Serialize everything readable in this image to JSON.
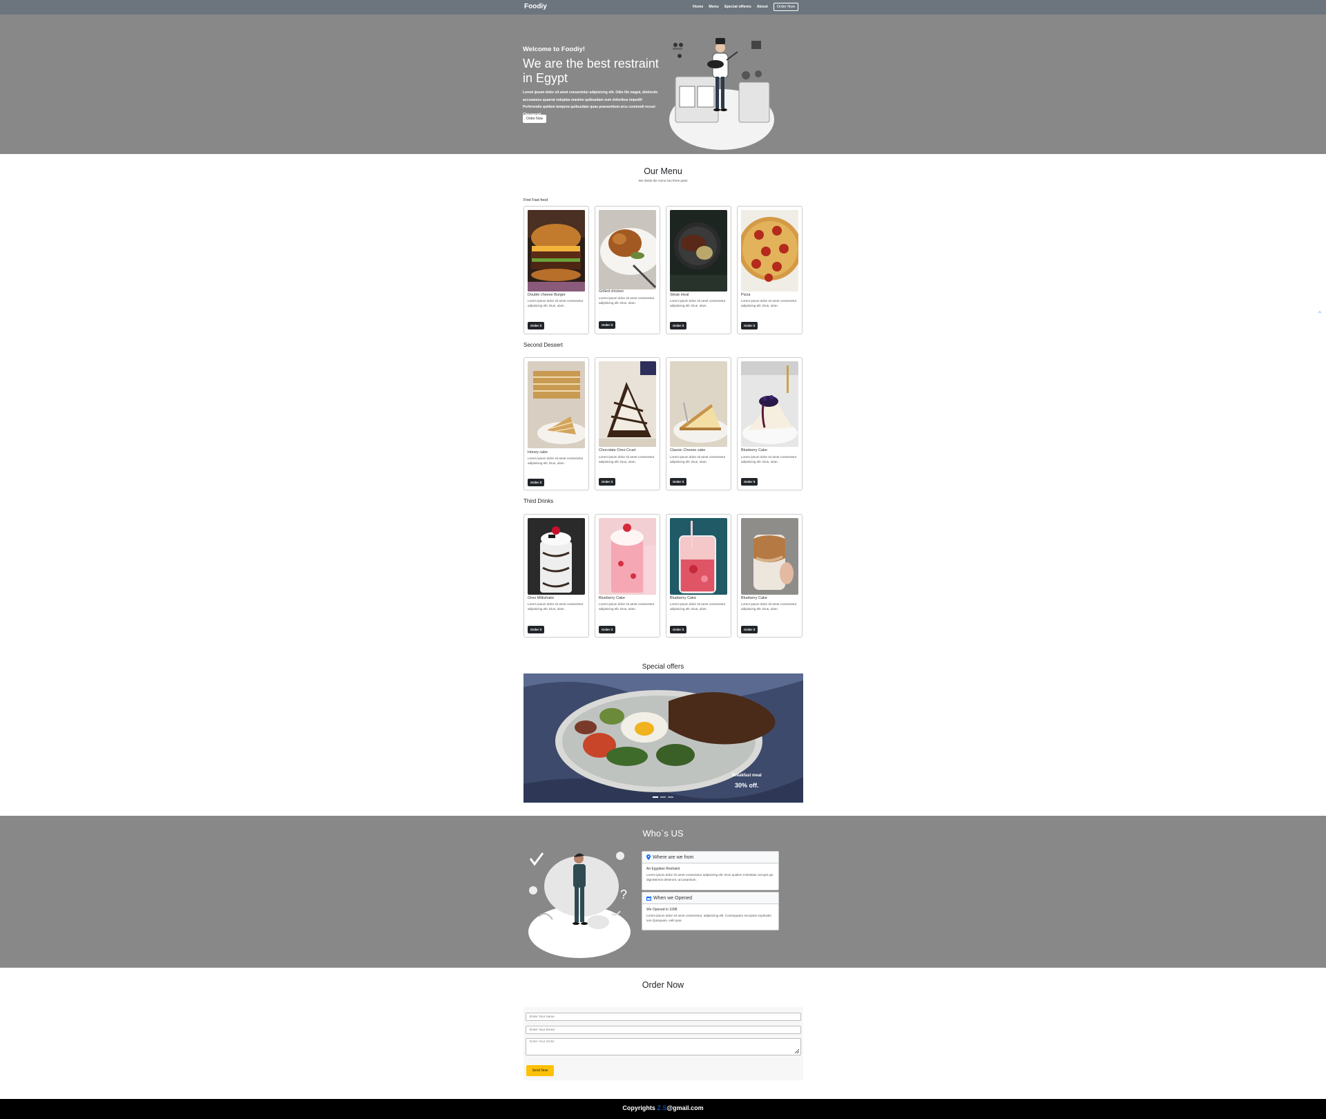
{
  "navbar": {
    "brand": "Foodiy",
    "links": [
      "Home",
      "Menu",
      "Special offeres",
      "About"
    ],
    "order_button": "Order Now",
    "bg_color": "#6c757d"
  },
  "hero": {
    "welcome": "Welcome to Foodiy!",
    "title": "We are the best restraint in Egypt",
    "text": "Lorem ipsum dolor sit amet consectetur adipisicing elit. Odio illo magni, distinctio accusamus quaerat voluptas maxime quibusdam eum doloribus impedit! Perferendis quidem tempora quibusdam quas praesentium arcu commodi recusi Chozaecati.",
    "button": "Order Now",
    "illustration": "chef-cooking-illustration"
  },
  "menu": {
    "title": "Our Menu",
    "subtitle": "We divide the menu into three parts",
    "card_button": "Order it",
    "card_text": "Lorem ipsum dolor sit amet consectetur adipisicing elit. Eius, ulam.",
    "categories": [
      {
        "label": "First Fast food",
        "items": [
          {
            "name": "Double cheese Burger"
          },
          {
            "name": "Grilled chicken"
          },
          {
            "name": "Steak meal"
          },
          {
            "name": "Pizza"
          }
        ]
      },
      {
        "label": "Second Dessert",
        "items": [
          {
            "name": "Honey cake"
          },
          {
            "name": "Chocolate Oreo Crust"
          },
          {
            "name": "Classic Cheese cake"
          },
          {
            "name": "Blueberry Cake"
          }
        ]
      },
      {
        "label": "Third Drinks",
        "items": [
          {
            "name": "Oreo Milkshake"
          },
          {
            "name": "Blueberry Cake"
          },
          {
            "name": "Blueberry Cake"
          },
          {
            "name": "Blueberry Cake"
          }
        ]
      }
    ]
  },
  "offers": {
    "title": "Special offers",
    "caption_title": "Breakfast meal",
    "caption_discount": "30% off."
  },
  "about": {
    "title": "Who`s US",
    "panels": [
      {
        "icon": "map-marker-icon",
        "heading": "Where are we from",
        "subheading": "An Egyptian Restraint",
        "text": "Lorem ipsum dolor sit amet consectetur adipisicing elit. Eros quidem molestias corrupti qui dignissimos deserunt, accusantium."
      },
      {
        "icon": "calendar-icon",
        "heading": "When we Opened",
        "subheading": "We Opened in 1998",
        "text": "Lorem ipsum dolor sit amet consectetur, adipisicing elit. Consequatur excepturi explicabo iure Quisquam, velit quia"
      }
    ]
  },
  "order": {
    "title": "Order Now",
    "name_placeholder": "Enter Your name",
    "email_placeholder": "Enter Your Email",
    "order_placeholder": "Enter Your Order",
    "send_button": "Send Now",
    "button_color": "#ffc107"
  },
  "footer": {
    "prefix": "Copyrights ",
    "accent": "Z.S",
    "suffix": "@gmail.com",
    "accent_color": "#0d6efd"
  }
}
